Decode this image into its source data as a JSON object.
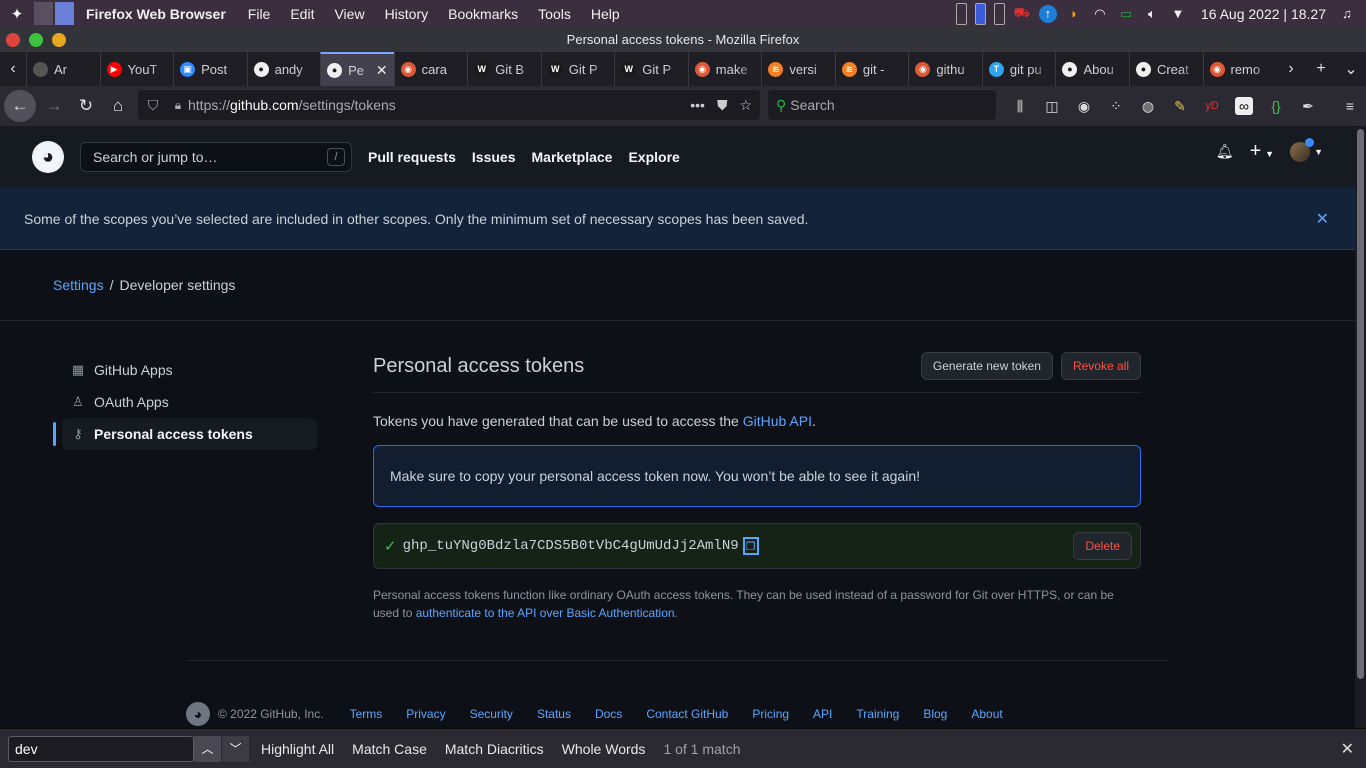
{
  "os": {
    "app_name": "Firefox Web Browser",
    "menu": [
      "File",
      "Edit",
      "View",
      "History",
      "Bookmarks",
      "Tools",
      "Help"
    ],
    "clock": "16 Aug 2022 | 18.27"
  },
  "window": {
    "title": "Personal access tokens - Mozilla Firefox"
  },
  "tabs": [
    {
      "title": "Ar",
      "color": "#555555",
      "glyph": ""
    },
    {
      "title": "YouT",
      "color": "#ff0000",
      "glyph": "▶"
    },
    {
      "title": "Post",
      "color": "#2d8cff",
      "glyph": "▣"
    },
    {
      "title": "andy",
      "color": "#f0f0f0",
      "glyph": "●"
    },
    {
      "title": "Pe",
      "color": "#f0f0f0",
      "glyph": "●"
    },
    {
      "title": "cara",
      "color": "#de5833",
      "glyph": "◉"
    },
    {
      "title": "Git B",
      "color": "#1a1a1a",
      "glyph": "W"
    },
    {
      "title": "Git P",
      "color": "#1a1a1a",
      "glyph": "W"
    },
    {
      "title": "Git P",
      "color": "#1a1a1a",
      "glyph": "W"
    },
    {
      "title": "make",
      "color": "#de5833",
      "glyph": "◉"
    },
    {
      "title": "versi",
      "color": "#f48024",
      "glyph": "≋"
    },
    {
      "title": "git -",
      "color": "#f48024",
      "glyph": "≋"
    },
    {
      "title": "githu",
      "color": "#de5833",
      "glyph": "◉"
    },
    {
      "title": "git pu",
      "color": "#2ea3f2",
      "glyph": "T"
    },
    {
      "title": "Abou",
      "color": "#f0f0f0",
      "glyph": "●"
    },
    {
      "title": "Creat",
      "color": "#f0f0f0",
      "glyph": "●"
    },
    {
      "title": "remo",
      "color": "#de5833",
      "glyph": "◉"
    }
  ],
  "navbar": {
    "url_prefix": "https://",
    "url_host": "github.com",
    "url_path": "/settings/tokens",
    "search_placeholder": "Search"
  },
  "github": {
    "search_placeholder": "Search or jump to…",
    "search_key": "/",
    "nav": [
      "Pull requests",
      "Issues",
      "Marketplace",
      "Explore"
    ],
    "plus": "+",
    "flash": "Some of the scopes you’ve selected are included in other scopes. Only the minimum set of necessary scopes has been saved.",
    "breadcrumb": {
      "root": "Settings",
      "sep": "/",
      "current": "Developer settings"
    },
    "sidebar": [
      {
        "label": "GitHub Apps",
        "icon": "apps-icon"
      },
      {
        "label": "OAuth Apps",
        "icon": "person-icon"
      },
      {
        "label": "Personal access tokens",
        "icon": "key-icon"
      }
    ],
    "title": "Personal access tokens",
    "generate_label": "Generate new token",
    "revoke_label": "Revoke all",
    "intro_text": "Tokens you have generated that can be used to access the ",
    "intro_link": "GitHub API",
    "intro_end": ".",
    "notice": "Make sure to copy your personal access token now. You won’t be able to see it again!",
    "token": "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",
    "delete_label": "Delete",
    "fine_text": "Personal access tokens function like ordinary OAuth access tokens. They can be used instead of a password for Git over HTTPS, or can be used to ",
    "fine_link": "authenticate to the API over Basic Authentication",
    "fine_end": ".",
    "footer_copy": "© 2022 GitHub, Inc.",
    "footer_links": [
      "Terms",
      "Privacy",
      "Security",
      "Status",
      "Docs",
      "Contact GitHub",
      "Pricing",
      "API",
      "Training",
      "Blog",
      "About"
    ]
  },
  "findbar": {
    "query": "dev",
    "options": [
      "Highlight All",
      "Match Case",
      "Match Diacritics",
      "Whole Words"
    ],
    "status": "1 of 1 match"
  }
}
